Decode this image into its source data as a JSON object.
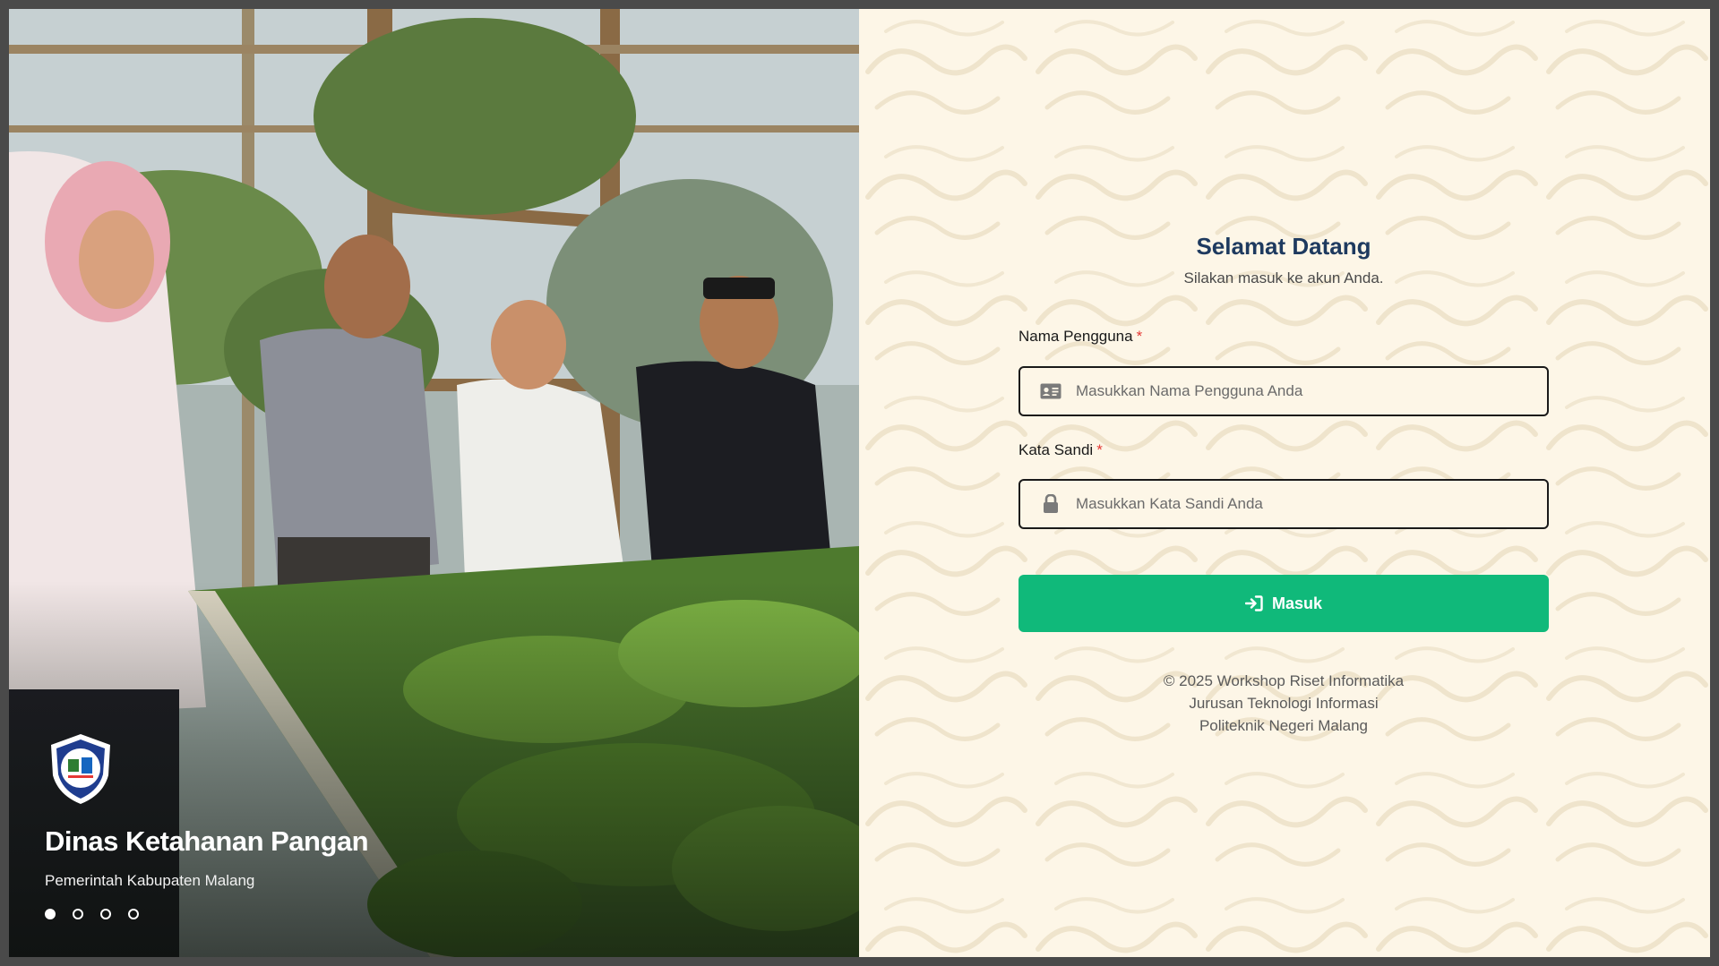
{
  "hero": {
    "title": "Dinas Ketahanan Pangan",
    "subtitle": "Pemerintah Kabupaten Malang",
    "slides": 4,
    "active_slide": 1,
    "logo_icon": "shield-logo-icon"
  },
  "login": {
    "welcome_title": "Selamat Datang",
    "welcome_subtitle": "Silakan masuk ke akun Anda.",
    "username_label": "Nama Pengguna",
    "username_placeholder": "Masukkan Nama Pengguna Anda",
    "username_icon": "id-card-icon",
    "password_label": "Kata Sandi",
    "password_placeholder": "Masukkan Kata Sandi Anda",
    "password_icon": "lock-icon",
    "required_marker": "*",
    "submit_label": "Masuk",
    "submit_icon": "sign-in-icon"
  },
  "footer": {
    "line1": "© 2025 Workshop Riset Informatika",
    "line2": "Jurusan Teknologi Informasi",
    "line3": "Politeknik Negeri Malang"
  },
  "colors": {
    "accent": "#10b97a",
    "title": "#1e3a5f",
    "panel_bg": "#fdf6e7",
    "required": "#e53935"
  }
}
